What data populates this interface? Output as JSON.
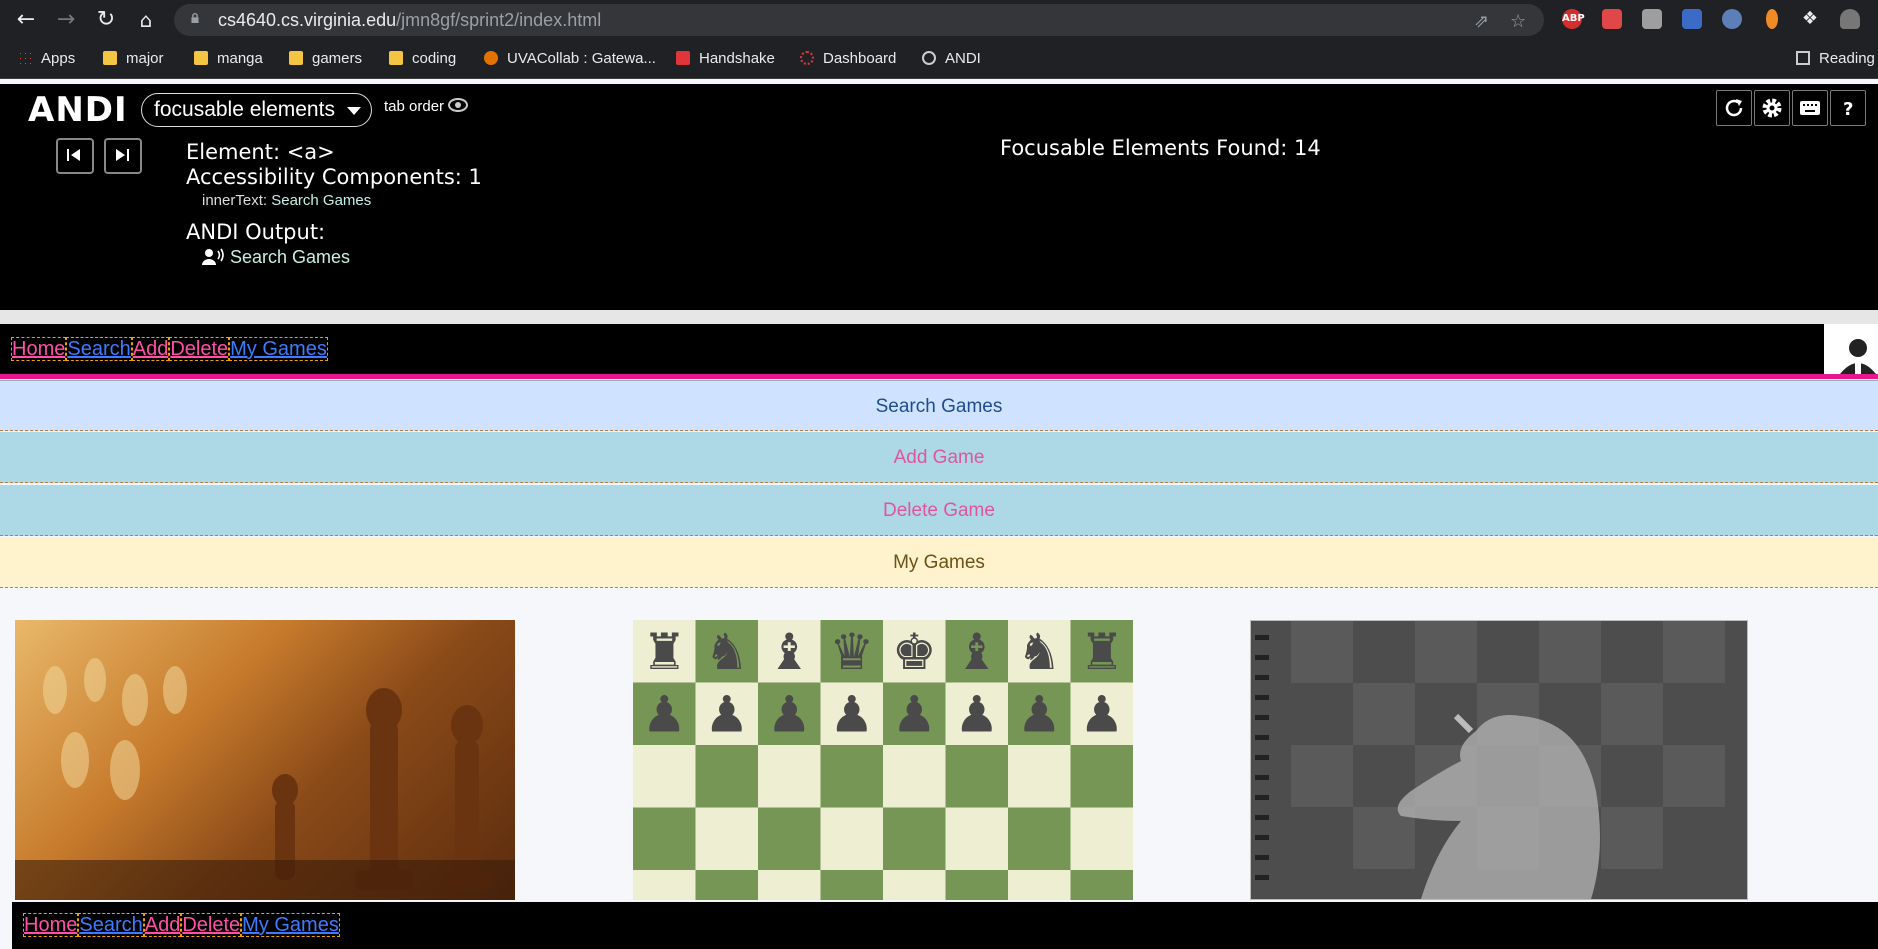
{
  "browser": {
    "url_host": "cs4640.cs.virginia.edu",
    "url_path": "/jmn8gf/sprint2/index.html",
    "bookmarks": [
      {
        "label": "Apps",
        "icon": "apps-grid-icon"
      },
      {
        "label": "major",
        "icon": "folder-icon"
      },
      {
        "label": "manga",
        "icon": "folder-icon"
      },
      {
        "label": "gamers",
        "icon": "folder-icon"
      },
      {
        "label": "coding",
        "icon": "folder-icon"
      },
      {
        "label": "UVACollab : Gatewa...",
        "icon": "uva-icon"
      },
      {
        "label": "Handshake",
        "icon": "handshake-icon"
      },
      {
        "label": "Dashboard",
        "icon": "dashboard-icon"
      },
      {
        "label": "ANDI",
        "icon": "globe-icon"
      }
    ],
    "reading_list": "Reading",
    "extensions": [
      "ABP"
    ]
  },
  "andi": {
    "logo": "ANDI",
    "module": "focusable elements",
    "tab_order": "tab order",
    "element": "Element: <a>",
    "components": "Accessibility Components: 1",
    "inner_key": "innerText:",
    "inner_val": "Search Games",
    "output_label": "ANDI Output:",
    "output_val": "Search Games",
    "found": "Focusable Elements Found: 14"
  },
  "nav": {
    "home": "Home",
    "search": "Search",
    "add": "Add",
    "delete": "Delete",
    "my_games": "My Games"
  },
  "bands": {
    "search": "Search Games",
    "add": "Add Game",
    "delete": "Delete Game",
    "my_games": "My Games"
  },
  "colors": {
    "link_pink": "#ff4fa8",
    "link_blue": "#3d7cff",
    "pink_bar": "#e8158c",
    "board_dark": "#769656",
    "board_light": "#eeeed2"
  }
}
